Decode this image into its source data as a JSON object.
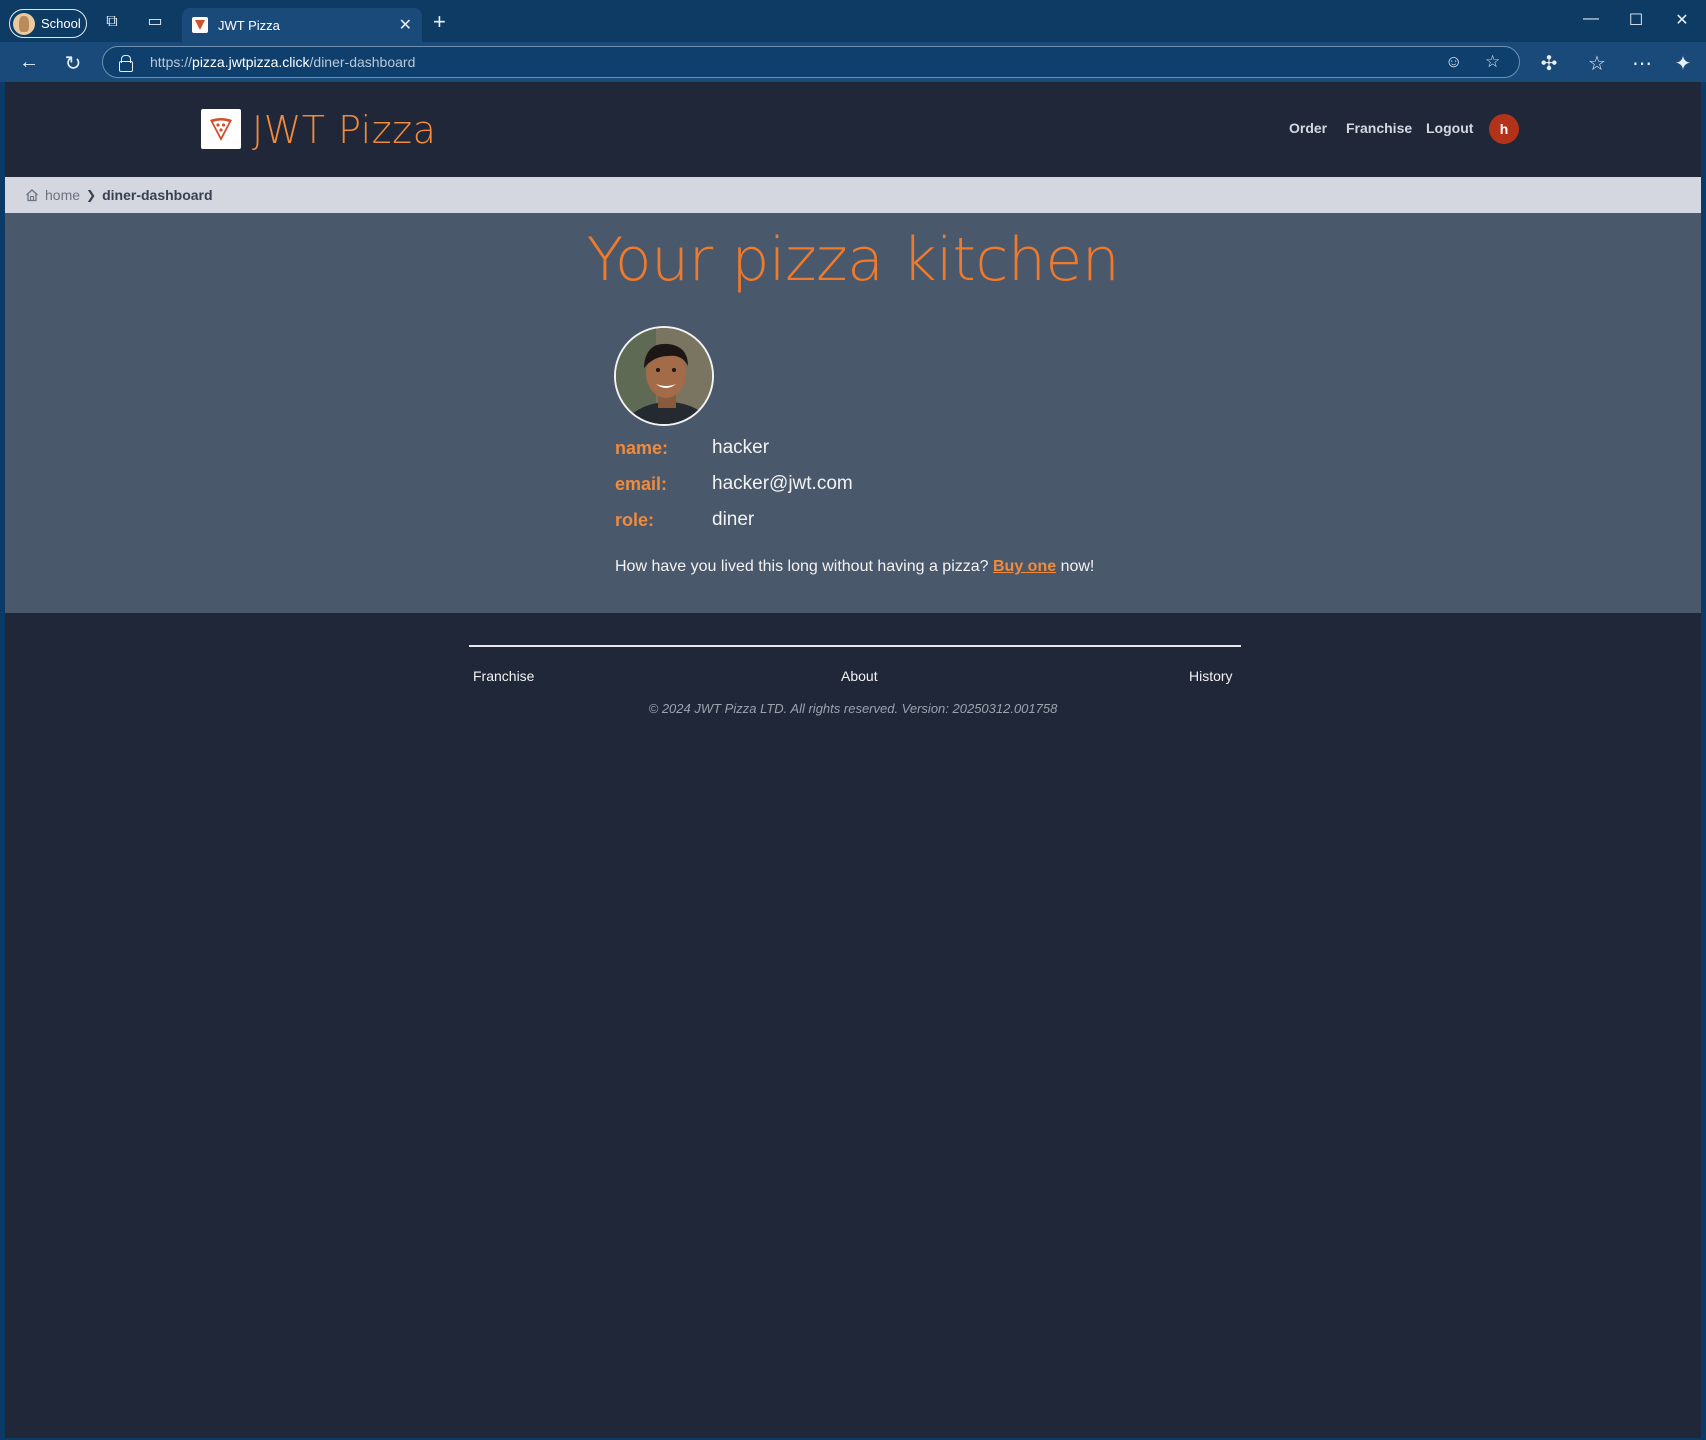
{
  "browser": {
    "profile_label": "School",
    "tab_title": "JWT Pizza",
    "url_prefix": "https://",
    "url_host": "pizza.jwtpizza.click",
    "url_path": "/diner-dashboard"
  },
  "header": {
    "brand": "JWT Pizza",
    "nav": {
      "order": "Order",
      "franchise": "Franchise",
      "logout": "Logout"
    },
    "user_initial": "h"
  },
  "breadcrumb": {
    "home": "home",
    "current": "diner-dashboard"
  },
  "main": {
    "title": "Your pizza kitchen",
    "profile": {
      "name_label": "name:",
      "name_value": "hacker",
      "email_label": "email:",
      "email_value": "hacker@jwt.com",
      "role_label": "role:",
      "role_value": "diner"
    },
    "promo_before": "How have you lived this long without having a pizza? ",
    "promo_link": "Buy one",
    "promo_after": " now!"
  },
  "footer": {
    "franchise": "Franchise",
    "about": "About",
    "history": "History",
    "copyright": "© 2024 JWT Pizza LTD. All rights reserved. Version: 20250312.001758"
  },
  "colors": {
    "accent": "#f08a3c",
    "header_bg": "#1f2738",
    "main_bg": "#4a586c",
    "breadcrumb_bg": "#d4d7e0",
    "user_badge": "#b3321a"
  }
}
